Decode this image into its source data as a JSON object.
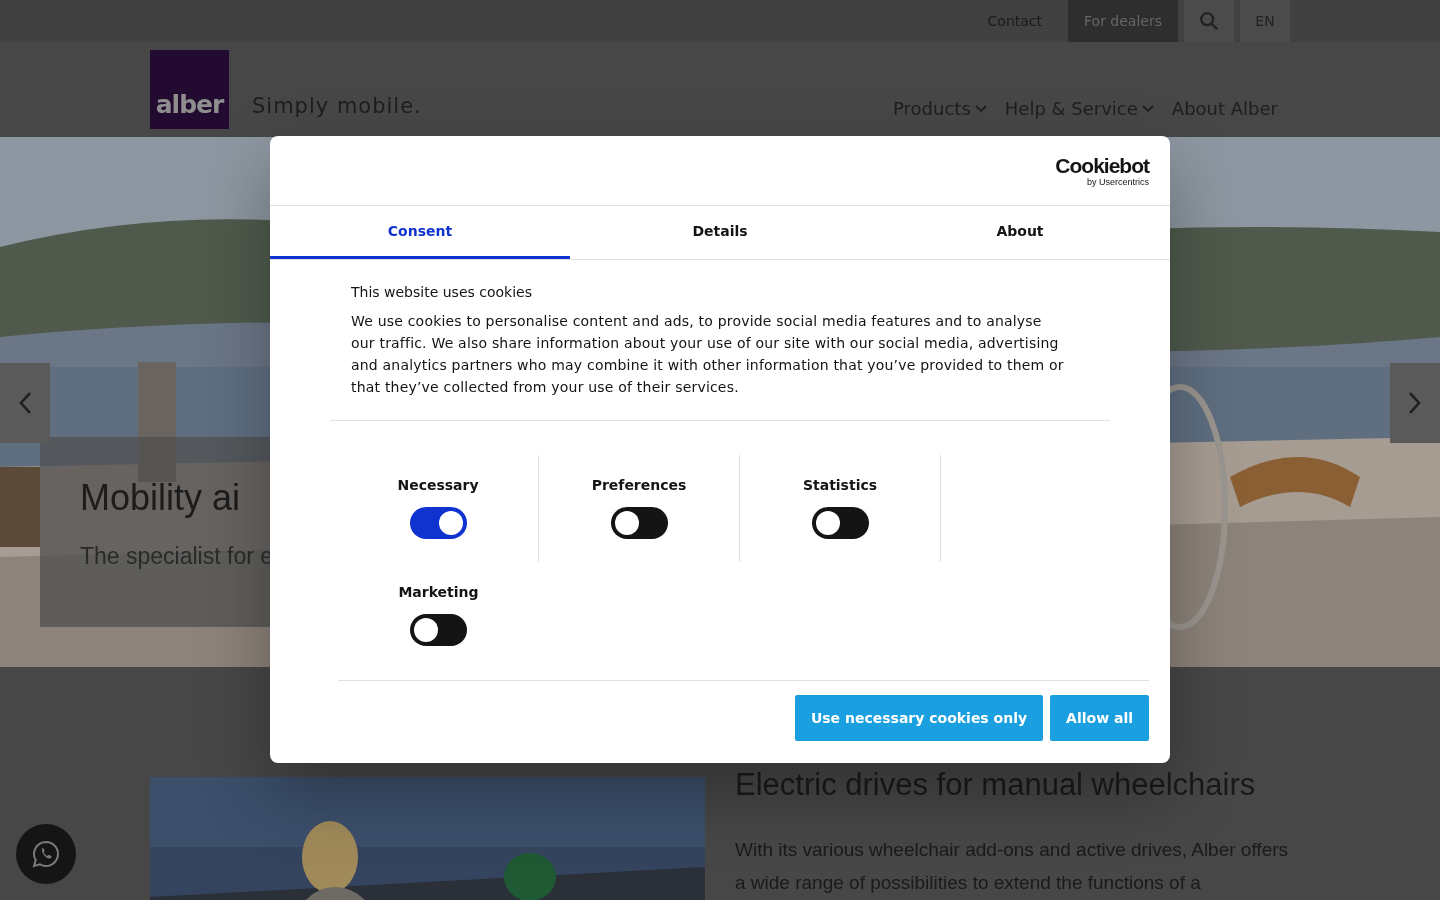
{
  "top_bar": [
    {
      "kind": "link",
      "label": "Contact"
    },
    {
      "kind": "button",
      "label": "For dealers"
    },
    {
      "kind": "search"
    },
    {
      "kind": "lang",
      "label": "EN"
    }
  ],
  "logo": {
    "text": "alber",
    "tagline": "Simply mobile."
  },
  "nav": [
    {
      "label": "Products",
      "has_menu": true
    },
    {
      "label": "Help & Service",
      "has_menu": true
    },
    {
      "label": "About Alber",
      "has_menu": false
    }
  ],
  "hero": {
    "title": "Mobility ai",
    "subtitle": "The specialist for e"
  },
  "cookie_dialog": {
    "brand": "Cookiebot",
    "brand_sub": "by Usercentrics",
    "tabs": [
      {
        "label": "Consent",
        "selected": true
      },
      {
        "label": "Details",
        "selected": false
      },
      {
        "label": "About",
        "selected": false
      }
    ],
    "heading": "This website uses cookies",
    "body": "We use cookies to personalise content and ads, to provide social media features and to analyse our traffic. We also share information about your use of our site with our social media, advertising and analytics partners who may combine it with other information that you’ve provided to them or that they’ve collected from your use of their services.",
    "toggles": [
      {
        "label": "Necessary",
        "on": true
      },
      {
        "label": "Preferences",
        "on": false
      },
      {
        "label": "Statistics",
        "on": false
      },
      {
        "label": "Marketing",
        "on": false
      }
    ],
    "buttons": [
      "Use necessary cookies only",
      "Allow all"
    ]
  },
  "section": {
    "title": "Electric drives for manual wheelchairs",
    "body": "With its various wheelchair add-ons and active drives, Alber offers a wide range of possibilities to extend the functions of a"
  }
}
